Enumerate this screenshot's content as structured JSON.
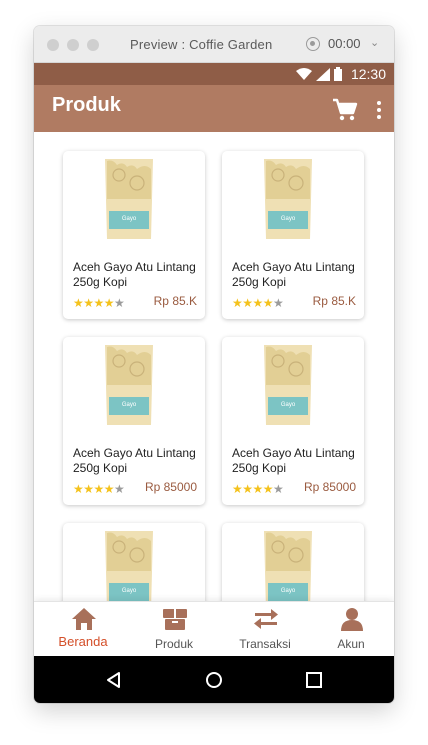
{
  "window": {
    "title": "Preview : Coffie Garden",
    "timer": "00:00"
  },
  "status_bar": {
    "time": "12:30"
  },
  "app_bar": {
    "title": "Produk"
  },
  "products": [
    {
      "name": "Aceh Gayo Atu Lintang 250g Kopi",
      "price": "Rp 85.K",
      "rating": 4,
      "label": "Gayo"
    },
    {
      "name": "Aceh Gayo Atu Lintang 250g Kopi",
      "price": "Rp 85.K",
      "rating": 4,
      "label": "Gayo"
    },
    {
      "name": "Aceh Gayo Atu Lintang 250g Kopi",
      "price": "Rp 85000",
      "rating": 4,
      "label": "Gayo"
    },
    {
      "name": "Aceh Gayo Atu Lintang 250g Kopi",
      "price": "Rp 85000",
      "rating": 4,
      "label": "Gayo"
    },
    {
      "name": "",
      "price": "",
      "rating": 0,
      "label": "Gayo"
    },
    {
      "name": "",
      "price": "",
      "rating": 0,
      "label": "Gayo"
    }
  ],
  "bottom_nav": [
    {
      "label": "Beranda",
      "icon": "home-icon",
      "active": true
    },
    {
      "label": "Produk",
      "icon": "box-icon",
      "active": false
    },
    {
      "label": "Transaksi",
      "icon": "transfer-icon",
      "active": false
    },
    {
      "label": "Akun",
      "icon": "person-icon",
      "active": false
    }
  ],
  "colors": {
    "status_bar": "#8f5d47",
    "app_bar": "#b07b62",
    "active_nav": "#d44f29",
    "nav_icon": "#a8705a",
    "price": "#9a5b40",
    "star": "#f4c21c"
  }
}
